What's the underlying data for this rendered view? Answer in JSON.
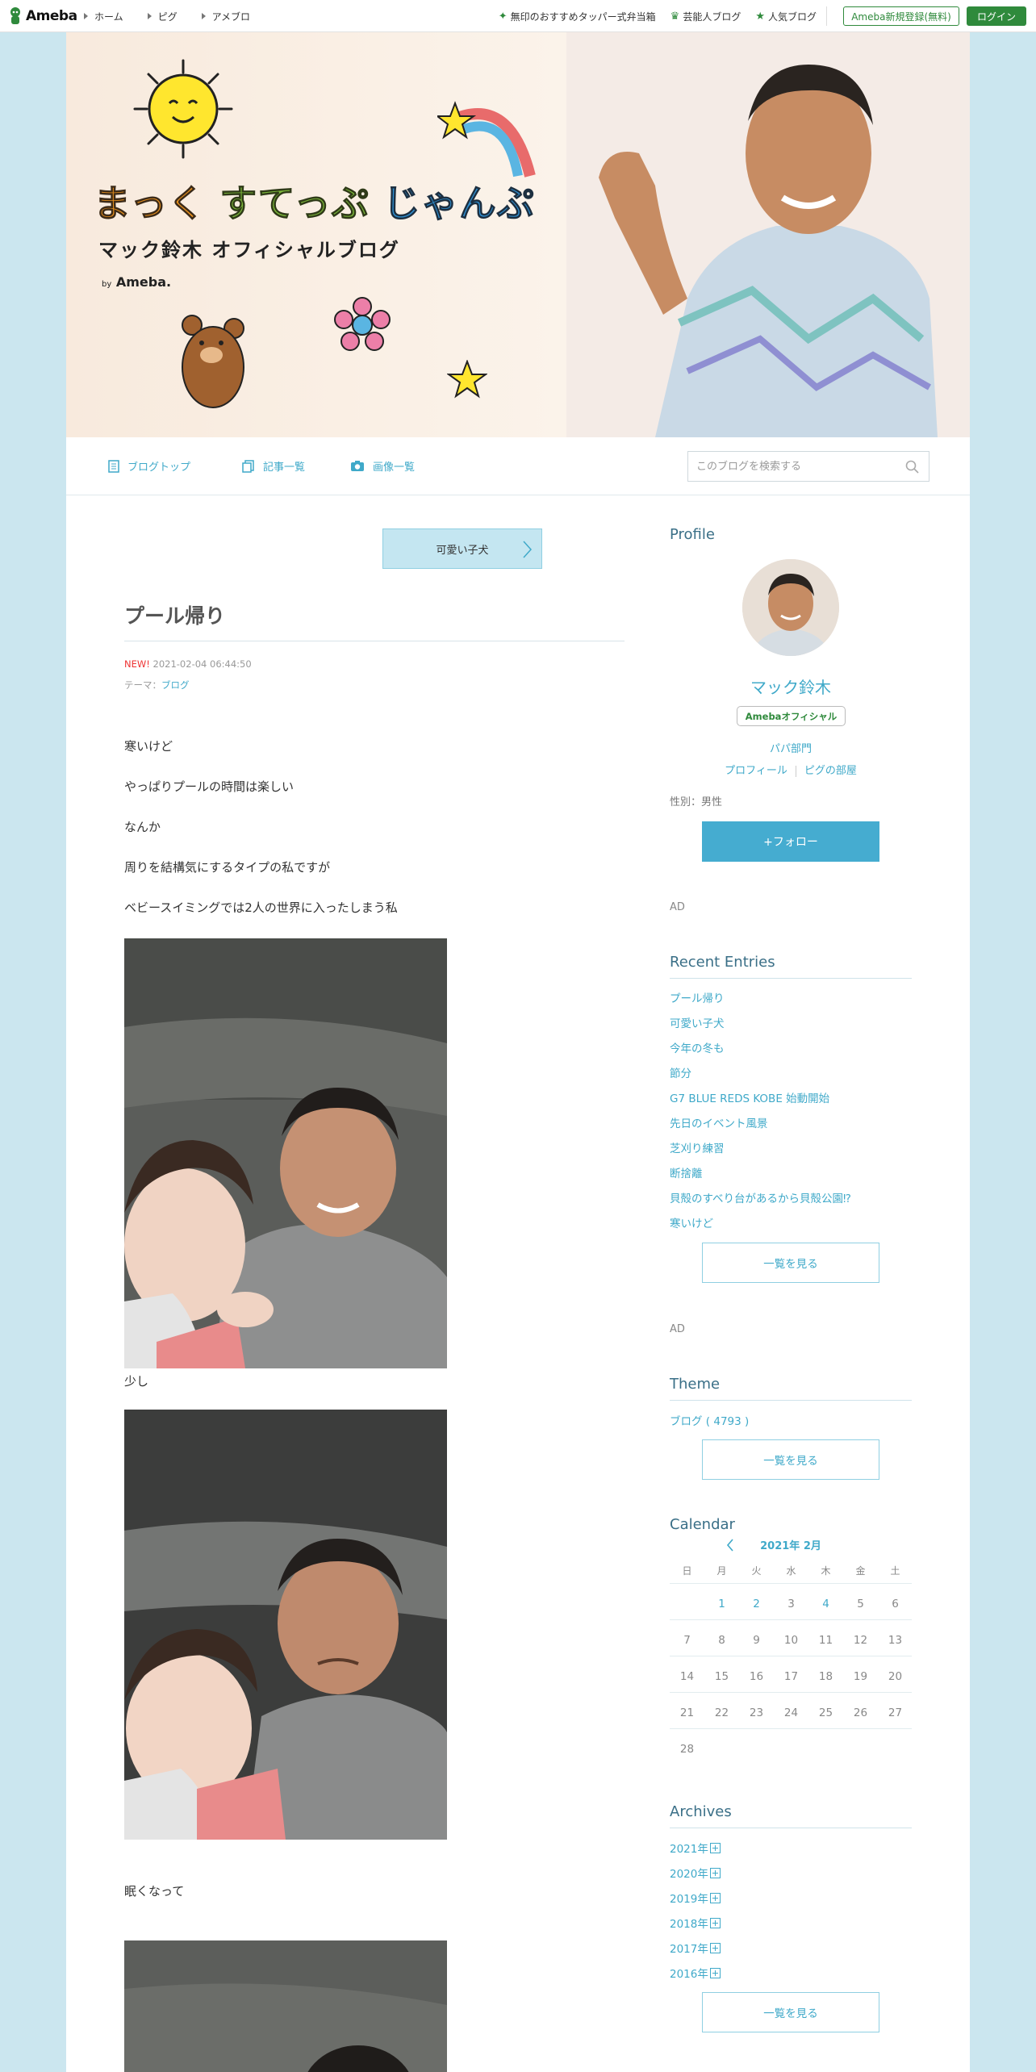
{
  "topbar": {
    "logo_text": "Ameba",
    "nav": [
      "ホーム",
      "ピグ",
      "アメブロ"
    ],
    "links": [
      {
        "icon": "sparkle-icon",
        "label": "無印のおすすめタッパー式弁当箱"
      },
      {
        "icon": "crown-icon",
        "label": "芸能人ブログ"
      },
      {
        "icon": "star-icon",
        "label": "人気ブログ"
      }
    ],
    "register_label": "Ameba新規登録(無料)",
    "login_label": "ログイン"
  },
  "header": {
    "title_part1": "まっく",
    "title_part2": "すてっぷ",
    "title_part3": "じゃんぷ",
    "subtitle": "マック鈴木 オフィシャルブログ",
    "by_prefix": "by",
    "by_brand": "Ameba."
  },
  "blognav": {
    "items": [
      "ブログトップ",
      "記事一覧",
      "画像一覧"
    ],
    "search_placeholder": "このブログを検索する"
  },
  "article": {
    "prev_label": "可愛い子犬",
    "title": "プール帰り",
    "new_badge": "NEW!",
    "date": "2021-02-04 06:44:50",
    "theme_prefix": "テーマ：",
    "theme": "ブログ",
    "paragraphs": [
      "寒いけど",
      "やっぱりプールの時間は楽しい",
      "なんか",
      "周りを結構気にするタイプの私ですが",
      "ベビースイミングでは2人の世界に入ったしまう私"
    ],
    "caption1": "少し",
    "caption2": "眠くなって"
  },
  "sidebar": {
    "profile": {
      "heading": "Profile",
      "name": "マック鈴木",
      "badge": "Amebaオフィシャル",
      "category": "パパ部門",
      "link_profile": "プロフィール",
      "link_pig": "ピグの部屋",
      "gender": "性別：男性",
      "follow": "+フォロー"
    },
    "ad": "AD",
    "recent": {
      "heading": "Recent Entries",
      "items": [
        "プール帰り",
        "可愛い子犬",
        "今年の冬も",
        "節分",
        "G7 BLUE REDS KOBE 始動開始",
        "先日のイベント風景",
        "芝刈り練習",
        "断捨離",
        "貝殻のすべり台があるから貝殻公園⁉",
        "寒いけど"
      ],
      "more": "一覧を見る"
    },
    "theme": {
      "heading": "Theme",
      "item": "ブログ ( 4793 )",
      "more": "一覧を見る"
    },
    "calendar": {
      "heading": "Calendar",
      "month": "2021年 2月",
      "weekdays": [
        "日",
        "月",
        "火",
        "水",
        "木",
        "金",
        "土"
      ],
      "weeks": [
        [
          "",
          "1",
          "2",
          "3",
          "4",
          "5",
          "6"
        ],
        [
          "7",
          "8",
          "9",
          "10",
          "11",
          "12",
          "13"
        ],
        [
          "14",
          "15",
          "16",
          "17",
          "18",
          "19",
          "20"
        ],
        [
          "21",
          "22",
          "23",
          "24",
          "25",
          "26",
          "27"
        ],
        [
          "28",
          "",
          "",
          "",
          "",
          "",
          ""
        ]
      ],
      "active_days": [
        "1",
        "2",
        "4"
      ]
    },
    "archives": {
      "heading": "Archives",
      "items": [
        "2021年",
        "2020年",
        "2019年",
        "2018年",
        "2017年",
        "2016年"
      ],
      "more": "一覧を見る"
    }
  },
  "colors": {
    "background": "#cbe6ef",
    "accent": "#3fa9c9",
    "ameba_green": "#2f8a3c",
    "follow_button": "#45acd0"
  }
}
